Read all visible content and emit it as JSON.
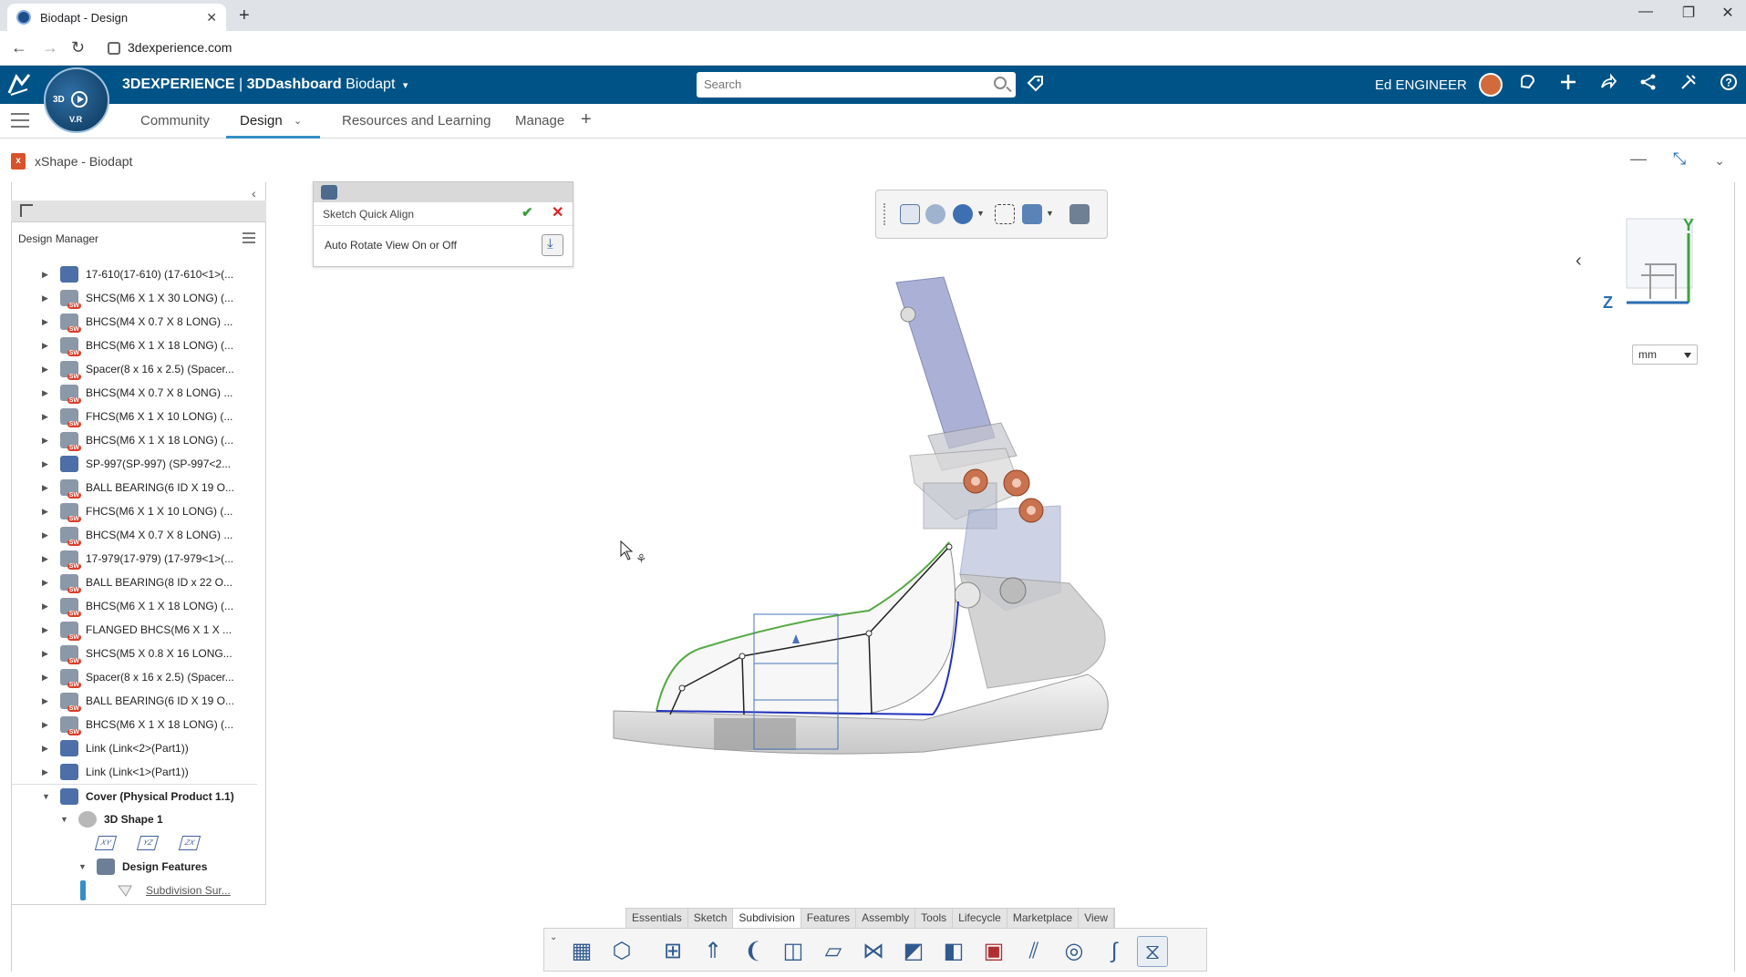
{
  "browser": {
    "tab_title": "Biodapt - Design",
    "tab_close": "✕",
    "new_tab": "+",
    "url": "3dexperience.com",
    "controls": {
      "minimize": "—",
      "restore": "❐",
      "close": "✕"
    },
    "nav": {
      "back": "←",
      "forward": "→",
      "reload": "↻"
    }
  },
  "topbar": {
    "brand_bold": "3DEXPERIENCE",
    "brand_sep": " | ",
    "brand_app": "3DDashboard",
    "brand_context": " Biodapt",
    "search_placeholder": "Search",
    "user": "Ed ENGINEER",
    "compass": {
      "label_3d": "3D",
      "label_vr": "V.R"
    },
    "icons": [
      "tag-icon",
      "feedback-icon",
      "add-icon",
      "share-icon",
      "social-share-icon",
      "tools-icon",
      "help-icon"
    ],
    "accent": "#005386"
  },
  "apptabs": {
    "items": [
      {
        "label": "Community"
      },
      {
        "label": "Design"
      },
      {
        "label": "Resources and Learning"
      },
      {
        "label": "Manage"
      }
    ],
    "add": "+",
    "active": "Design",
    "active_color": "#368ec4"
  },
  "app": {
    "title": "xShape - Biodapt"
  },
  "design_manager": {
    "title": "Design Manager",
    "items": [
      {
        "label": "17-610(17-610) (17-610<1>(...",
        "icon": "part-icon"
      },
      {
        "label": "SHCS(M6 X 1 X 30 LONG) (...",
        "icon": "solidworks-part-icon"
      },
      {
        "label": "BHCS(M4 X 0.7 X 8 LONG) ...",
        "icon": "solidworks-part-icon"
      },
      {
        "label": "BHCS(M6 X 1 X 18 LONG) (...",
        "icon": "solidworks-part-icon"
      },
      {
        "label": "Spacer(8 x 16 x 2.5) (Spacer...",
        "icon": "solidworks-part-icon"
      },
      {
        "label": "BHCS(M4 X 0.7 X 8 LONG) ...",
        "icon": "solidworks-part-icon"
      },
      {
        "label": "FHCS(M6 X 1 X 10 LONG) (...",
        "icon": "solidworks-part-icon"
      },
      {
        "label": "BHCS(M6 X 1 X 18 LONG) (...",
        "icon": "solidworks-part-icon"
      },
      {
        "label": "SP-997(SP-997) (SP-997<2...",
        "icon": "part-icon"
      },
      {
        "label": "BALL BEARING(6 ID X 19 O...",
        "icon": "solidworks-part-icon"
      },
      {
        "label": "FHCS(M6 X 1 X 10 LONG) (...",
        "icon": "solidworks-part-icon"
      },
      {
        "label": "BHCS(M4 X 0.7 X 8 LONG) ...",
        "icon": "solidworks-part-icon"
      },
      {
        "label": "17-979(17-979) (17-979<1>(...",
        "icon": "solidworks-part-icon"
      },
      {
        "label": "BALL BEARING(8 ID x 22 O...",
        "icon": "solidworks-part-icon"
      },
      {
        "label": "BHCS(M6 X 1 X 18 LONG) (...",
        "icon": "solidworks-part-icon"
      },
      {
        "label": "FLANGED BHCS(M6 X 1 X ...",
        "icon": "solidworks-part-icon"
      },
      {
        "label": "SHCS(M5 X 0.8 X 16 LONG...",
        "icon": "solidworks-part-icon"
      },
      {
        "label": "Spacer(8 x 16 x 2.5) (Spacer...",
        "icon": "solidworks-part-icon"
      },
      {
        "label": "BALL BEARING(6 ID X 19 O...",
        "icon": "solidworks-part-icon"
      },
      {
        "label": "BHCS(M6 X 1 X 18 LONG) (...",
        "icon": "solidworks-part-icon"
      },
      {
        "label": "Link (Link<2>(Part1))",
        "icon": "physical-product-icon"
      },
      {
        "label": "Link (Link<1>(Part1))",
        "icon": "physical-product-icon"
      }
    ],
    "cover": "Cover (Physical Product 1.1)",
    "shape": "3D Shape 1",
    "planes": [
      "XY",
      "YZ",
      "ZX"
    ],
    "features": "Design Features",
    "subdivision": "Subdivision Sur..."
  },
  "sketch_quick_align": {
    "title": "Sketch Quick Align",
    "option": "Auto Rotate View On or Off",
    "ok": "✔",
    "cancel": "✕"
  },
  "viewport": {
    "unit": "mm",
    "axis_y": "Y",
    "axis_z": "Z",
    "back": "‹"
  },
  "action_bar": {
    "tabs": [
      "Essentials",
      "Sketch",
      "Subdivision",
      "Features",
      "Assembly",
      "Tools",
      "Lifecycle",
      "Marketplace",
      "View"
    ],
    "active_tab": "Subdivision",
    "icons": [
      "subdivision-primitive-icon",
      "cube-icon",
      "grid-icon",
      "extrude-icon",
      "curve-surface-icon",
      "box-face-icon",
      "plane-icon",
      "bridge-icon",
      "shell-icon",
      "cube-open-icon",
      "delete-face-icon",
      "stroke-icon",
      "sphere-icon",
      "flow-icon",
      "symmetry-icon"
    ]
  }
}
